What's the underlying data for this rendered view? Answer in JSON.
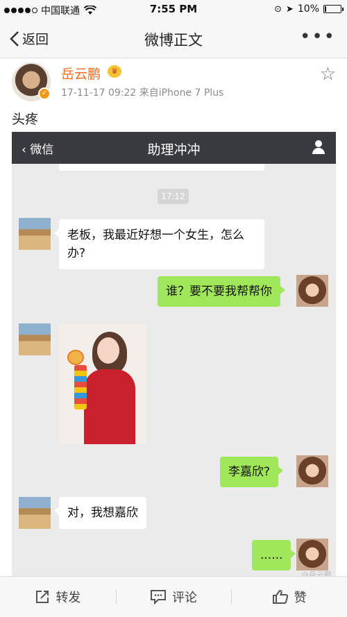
{
  "status_bar": {
    "carrier": "中国联通",
    "time": "7:55 PM",
    "battery": "10%",
    "battery_level": 0.1
  },
  "nav": {
    "back_label": "返回",
    "title": "微博正文",
    "more": "•••"
  },
  "post": {
    "username": "岳云鹏",
    "meta": "17-11-17 09:22  来自iPhone 7 Plus",
    "text": "头疼"
  },
  "chat": {
    "back_label": "微信",
    "title": "助理冲冲",
    "time_chip": "17:12",
    "messages": [
      {
        "side": "left",
        "text": "老板，我最近好想一个女生，怎么办?"
      },
      {
        "side": "right",
        "text": "谁？要不要我帮帮你"
      },
      {
        "side": "left",
        "type": "image"
      },
      {
        "side": "right",
        "text": "李嘉欣?"
      },
      {
        "side": "left",
        "text": "对，我想嘉欣"
      },
      {
        "side": "right",
        "text": "......"
      }
    ]
  },
  "watermark": "@岳云鹏",
  "toolbar": {
    "repost": "转发",
    "comment": "评论",
    "like": "赞"
  },
  "colors": {
    "username": "#f36c21",
    "wechat_bar": "#393a3f",
    "bubble_green": "#a0e75a"
  },
  "icons": [
    "back-chevron-icon",
    "more-icon",
    "star-icon",
    "verified-badge-icon",
    "crown-icon",
    "person-icon",
    "repost-icon",
    "comment-icon",
    "like-icon"
  ]
}
